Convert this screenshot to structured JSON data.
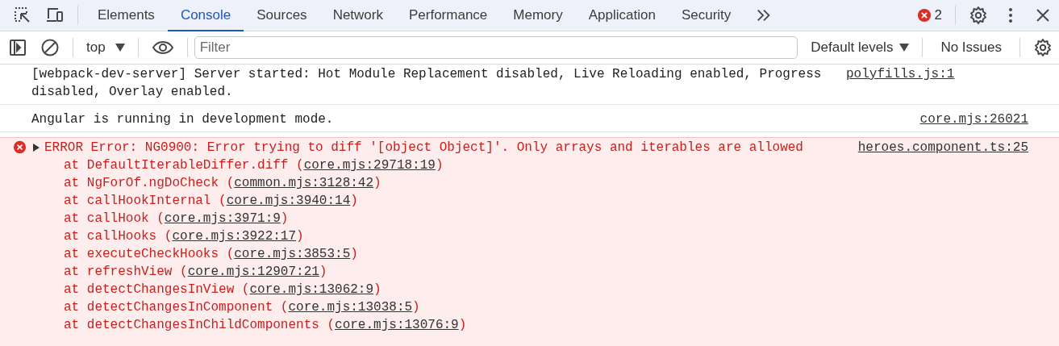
{
  "tabs": [
    {
      "label": "Elements",
      "selected": false
    },
    {
      "label": "Console",
      "selected": true
    },
    {
      "label": "Sources",
      "selected": false
    },
    {
      "label": "Network",
      "selected": false
    },
    {
      "label": "Performance",
      "selected": false
    },
    {
      "label": "Memory",
      "selected": false
    },
    {
      "label": "Application",
      "selected": false
    },
    {
      "label": "Security",
      "selected": false
    }
  ],
  "error_count": "2",
  "toolbar": {
    "context": "top",
    "filter_placeholder": "Filter",
    "levels": "Default levels",
    "issues": "No Issues"
  },
  "messages": [
    {
      "kind": "log",
      "text": "[webpack-dev-server] Server started: Hot Module Replacement disabled, Live Reloading enabled, Progress disabled, Overlay enabled.",
      "source": "polyfills.js:1"
    },
    {
      "kind": "log",
      "text": "Angular is running in development mode.",
      "source": "core.mjs:26021"
    },
    {
      "kind": "error",
      "expanded": false,
      "text": "ERROR Error: NG0900: Error trying to diff '[object Object]'. Only arrays and iterables are allowed",
      "source": "heroes.component.ts:25",
      "stack": [
        {
          "prefix": "at DefaultIterableDiffer.diff (",
          "link": "core.mjs:29718:19",
          "suffix": ")"
        },
        {
          "prefix": "at NgForOf.ngDoCheck (",
          "link": "common.mjs:3128:42",
          "suffix": ")"
        },
        {
          "prefix": "at callHookInternal (",
          "link": "core.mjs:3940:14",
          "suffix": ")"
        },
        {
          "prefix": "at callHook (",
          "link": "core.mjs:3971:9",
          "suffix": ")"
        },
        {
          "prefix": "at callHooks (",
          "link": "core.mjs:3922:17",
          "suffix": ")"
        },
        {
          "prefix": "at executeCheckHooks (",
          "link": "core.mjs:3853:5",
          "suffix": ")"
        },
        {
          "prefix": "at refreshView (",
          "link": "core.mjs:12907:21",
          "suffix": ")"
        },
        {
          "prefix": "at detectChangesInView (",
          "link": "core.mjs:13062:9",
          "suffix": ")"
        },
        {
          "prefix": "at detectChangesInComponent (",
          "link": "core.mjs:13038:5",
          "suffix": ")"
        },
        {
          "prefix": "at detectChangesInChildComponents (",
          "link": "core.mjs:13076:9",
          "suffix": ")"
        }
      ]
    }
  ]
}
